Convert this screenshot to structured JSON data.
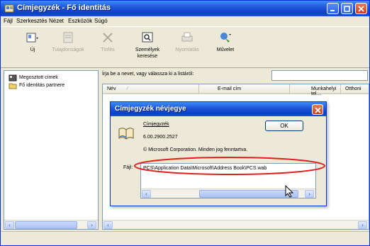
{
  "window": {
    "title": "Címjegyzék - Fő identitás"
  },
  "menu": [
    "Fájl",
    "Szerkesztés",
    "Nézet",
    "Eszközök",
    "Súgó"
  ],
  "toolbar": {
    "tools": [
      {
        "label": "Új",
        "icon": "new-contact-icon",
        "disabled": false
      },
      {
        "label": "Tulajdonságok",
        "icon": "properties-icon",
        "disabled": true
      },
      {
        "label": "Törlés",
        "icon": "delete-icon",
        "disabled": true
      },
      {
        "label": "Személyek keresése",
        "icon": "find-people-icon",
        "disabled": false
      },
      {
        "label": "Nyomtatás",
        "icon": "print-icon",
        "disabled": true
      },
      {
        "label": "Művelet",
        "icon": "action-icon",
        "disabled": false
      }
    ]
  },
  "tree": {
    "items": [
      "Megosztott címek",
      "Fő identitás partnere"
    ]
  },
  "search": {
    "label": "Írja be a nevet, vagy válassza ki a listáról:",
    "value": ""
  },
  "list": {
    "columns": [
      "Név",
      "E-mail cím",
      "Munkahelyi tel...",
      "Otthoni"
    ]
  },
  "dialog": {
    "title": "Címjegyzék névjegye",
    "app_name": "Címjegyzék",
    "version": "6.00.2900.2527",
    "copyright": "© Microsoft Corporation. Minden jog fenntartva.",
    "file_label": "Fájl:",
    "file_path": "PCS\\Application Data\\Microsoft\\Address Book\\PCS.wab",
    "ok_label": "OK"
  },
  "colors": {
    "title_blue": "#0a3fc9",
    "highlight_red": "#e02020"
  }
}
